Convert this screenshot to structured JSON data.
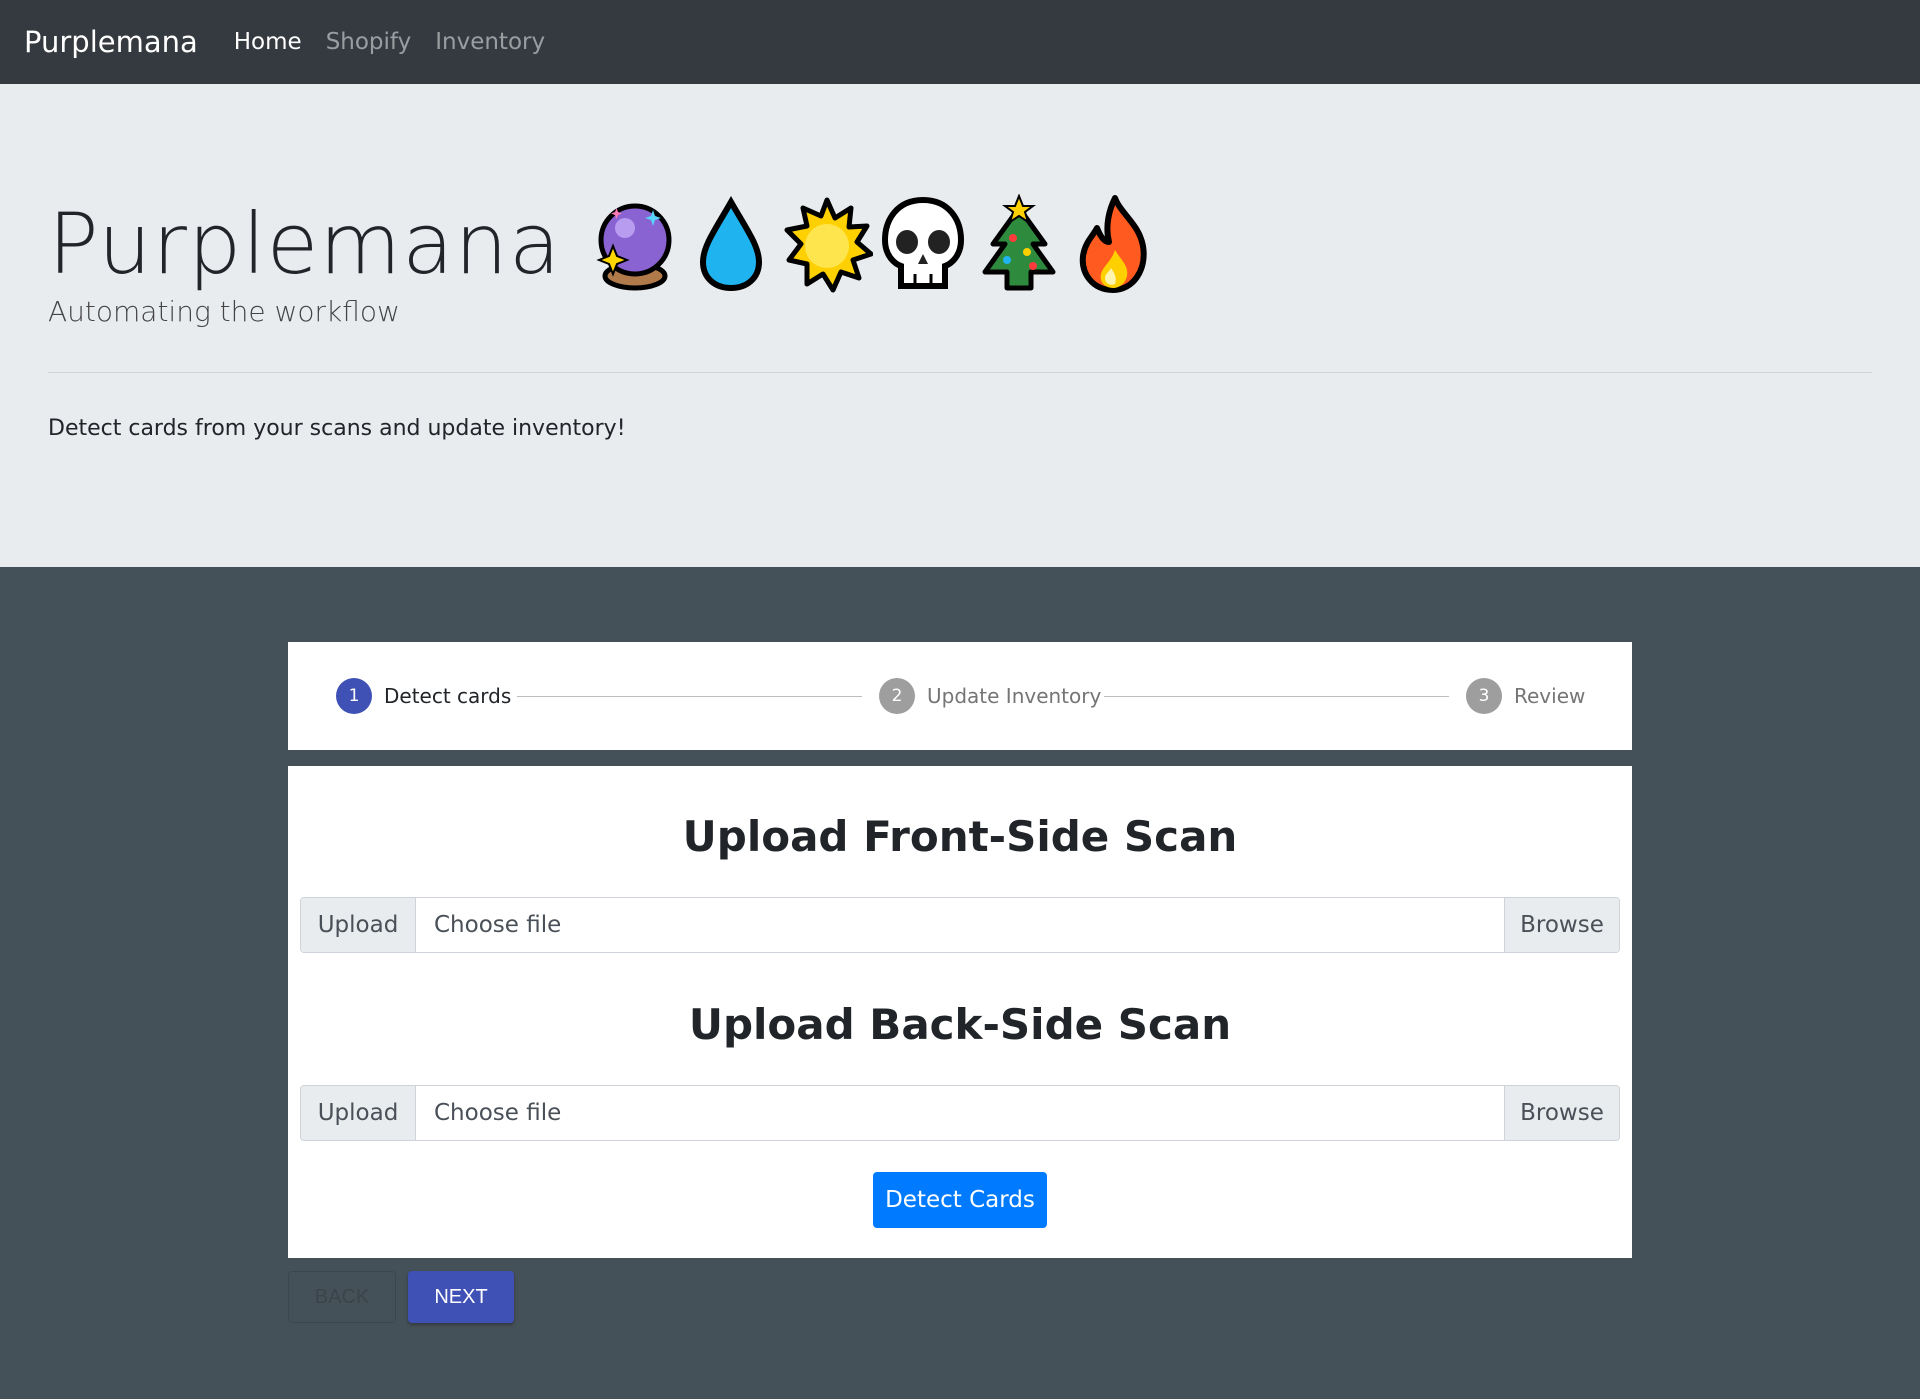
{
  "navbar": {
    "brand": "Purplemana",
    "links": [
      {
        "label": "Home",
        "active": true
      },
      {
        "label": "Shopify",
        "active": false
      },
      {
        "label": "Inventory",
        "active": false
      }
    ]
  },
  "jumbotron": {
    "title": "Purplemana",
    "emojis": [
      "crystal-ball-icon",
      "water-drop-icon",
      "sun-icon",
      "skull-icon",
      "christmas-tree-icon",
      "fire-icon"
    ],
    "lead": "Automating the workflow",
    "text": "Detect cards from your scans and update inventory!"
  },
  "stepper": {
    "steps": [
      {
        "number": "1",
        "label": "Detect cards",
        "active": true
      },
      {
        "number": "2",
        "label": "Update Inventory",
        "active": false
      },
      {
        "number": "3",
        "label": "Review",
        "active": false
      }
    ]
  },
  "upload": {
    "front_title": "Upload Front-Side Scan",
    "back_title": "Upload Back-Side Scan",
    "prepend_label": "Upload",
    "placeholder": "Choose file",
    "browse_label": "Browse",
    "detect_label": "Detect Cards"
  },
  "footer_buttons": {
    "back_label": "BACK",
    "next_label": "NEXT"
  },
  "colors": {
    "navbar": "#343a40",
    "background": "#455158",
    "primary": "#007bff",
    "stepper_active": "#3f51b5"
  }
}
